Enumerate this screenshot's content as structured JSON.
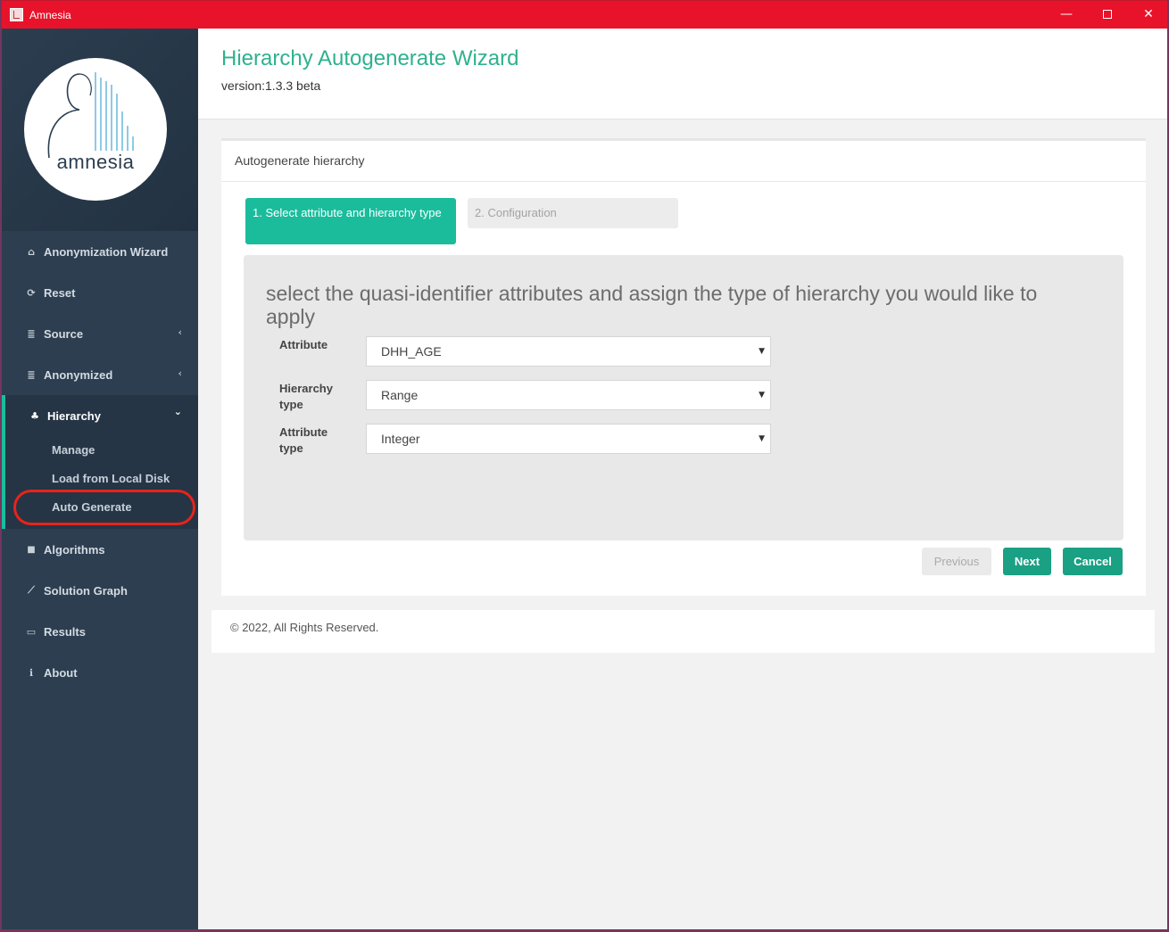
{
  "window": {
    "title": "Amnesia",
    "controls": [
      "minimize",
      "maximize",
      "close"
    ]
  },
  "sidebar": {
    "logo_text": "amnesia",
    "items": [
      {
        "label": "Anonymization Wizard",
        "icon": "home-icon",
        "glyph": "⌂"
      },
      {
        "label": "Reset",
        "icon": "refresh-icon",
        "glyph": "⟳"
      },
      {
        "label": "Source",
        "icon": "database-icon",
        "glyph": "≣",
        "chevron": "‹"
      },
      {
        "label": "Anonymized",
        "icon": "database-icon",
        "glyph": "≣",
        "chevron": "‹"
      }
    ],
    "hierarchy": {
      "label": "Hierarchy",
      "icon": "sitemap-icon",
      "glyph": "♣",
      "chevron": "⌄",
      "subitems": [
        "Manage",
        "Load from Local Disk",
        "Auto Generate"
      ],
      "highlighted": "Auto Generate",
      "highlight_color": "#e8231b"
    },
    "items_after": [
      {
        "label": "Algorithms",
        "icon": "lock-icon",
        "glyph": "🔒"
      },
      {
        "label": "Solution Graph",
        "icon": "chart-icon",
        "glyph": "⟋"
      },
      {
        "label": "Results",
        "icon": "laptop-icon",
        "glyph": "▭"
      },
      {
        "label": "About",
        "icon": "info-icon",
        "glyph": "ℹ"
      }
    ]
  },
  "header": {
    "title": "Hierarchy Autogenerate Wizard",
    "version": "version:1.3.3 beta"
  },
  "panel": {
    "heading": "Autogenerate hierarchy",
    "steps": [
      {
        "label": "1. Select attribute and hierarchy type",
        "active": true
      },
      {
        "label": "2. Configuration",
        "active": false
      }
    ],
    "instruction": "select the quasi-identifier attributes and assign the type of hierarchy you would like to apply",
    "fields": [
      {
        "label": "Attribute",
        "value": "DHH_AGE"
      },
      {
        "label": "Hierarchy type",
        "value": "Range"
      },
      {
        "label": "Attribute type",
        "value": "Integer"
      }
    ],
    "buttons": {
      "previous": "Previous",
      "next": "Next",
      "cancel": "Cancel"
    }
  },
  "footer": {
    "text": "© 2022, All Rights Reserved."
  },
  "colors": {
    "titlebar": "#e8132a",
    "accent": "#1abc9c",
    "sidebar": "#2c3e50",
    "title_text": "#2fb18e"
  }
}
